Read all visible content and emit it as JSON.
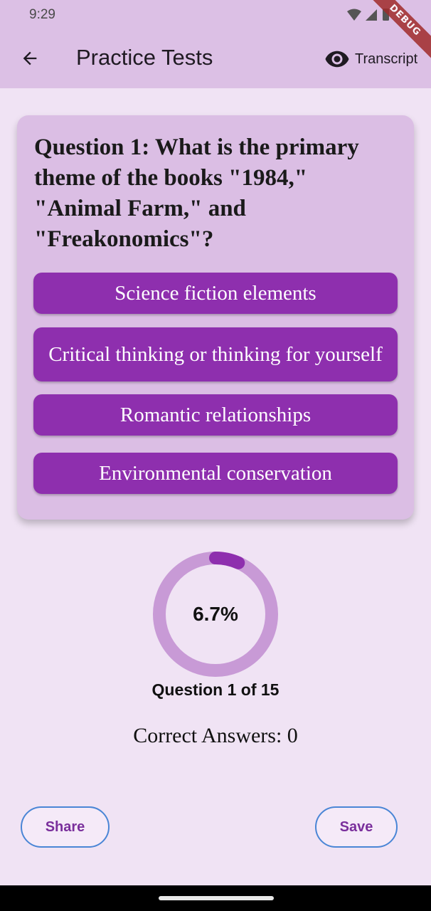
{
  "status_bar": {
    "time": "9:29"
  },
  "debug_banner": "DEBUG",
  "app_bar": {
    "title": "Practice Tests",
    "transcript_label": "Transcript"
  },
  "question": {
    "text": "Question 1: What is the primary theme of the books \"1984,\" \"Animal Farm,\" and \"Freakonomics\"?",
    "options": [
      "Science fiction elements",
      "Critical thinking or thinking for yourself",
      "Romantic relationships",
      "Environmental conservation"
    ]
  },
  "progress": {
    "percent_label": "6.7%",
    "fraction": 0.067,
    "question_count": "Question 1 of 15"
  },
  "score": {
    "correct_answers": "Correct Answers: 0"
  },
  "actions": {
    "share_label": "Share",
    "save_label": "Save"
  },
  "colors": {
    "accent": "#8e2fae",
    "card": "#dbbee4",
    "background": "#f0e3f4",
    "ring_track": "#c89ad6",
    "button_border": "#4a86d6"
  }
}
